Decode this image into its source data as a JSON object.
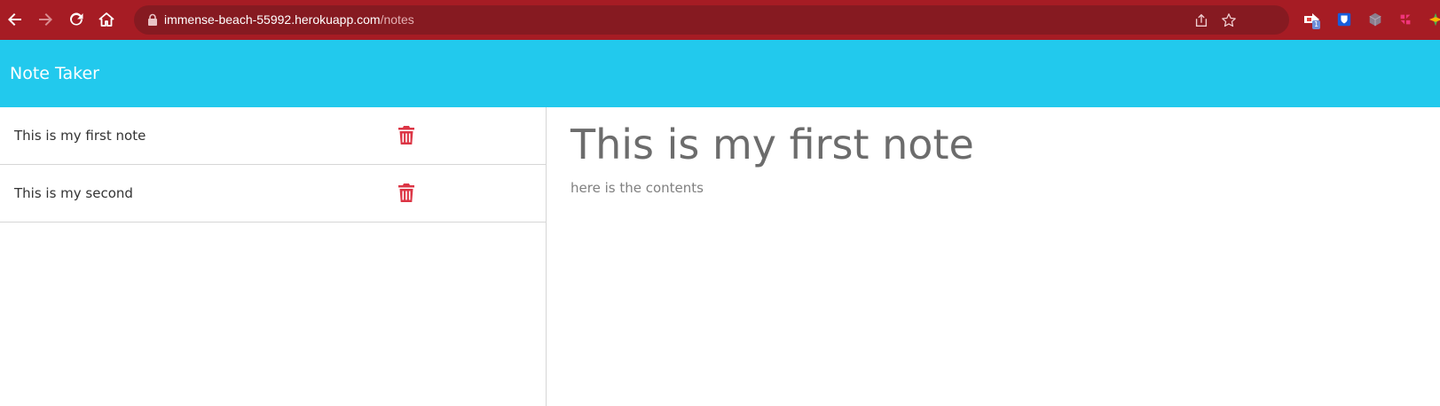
{
  "browser": {
    "url_host": "immense-beach-55992.herokuapp.com",
    "url_path": "/notes",
    "extension_badge": "1",
    "icons": [
      "back-arrow-icon",
      "forward-arrow-icon",
      "reload-icon",
      "home-icon",
      "lock-icon",
      "share-icon",
      "bookmark-star-icon"
    ],
    "bar_color": "#a61c24",
    "omnibox_color": "#861a21"
  },
  "app": {
    "brand": "Note Taker",
    "header_color": "#22c9ed",
    "delete_color": "#dc3545"
  },
  "notes": [
    {
      "title": "This is my first note"
    },
    {
      "title": "This is my second"
    }
  ],
  "active_note": {
    "title": "This is my first note",
    "text": "here is the contents"
  }
}
